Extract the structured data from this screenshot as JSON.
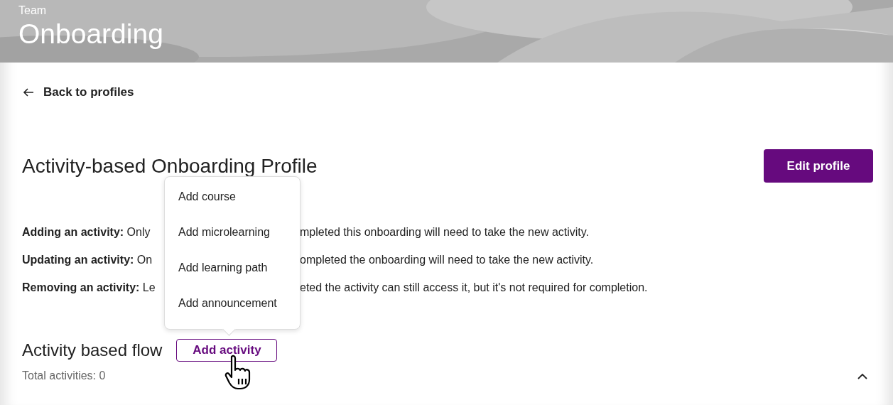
{
  "header": {
    "eyebrow": "Team",
    "title": "Onboarding"
  },
  "back_link": {
    "label": "Back to profiles"
  },
  "profile": {
    "title": "Activity-based Onboarding Profile",
    "edit_button": "Edit profile"
  },
  "rules": [
    {
      "visible_start": "**Adding an activity:** Only",
      "visible_end": "mpleted this onboarding will need to take the new activity."
    },
    {
      "visible_start": "**Updating an activity:** On",
      "visible_end": "ompleted the onboarding will need to take the new activity."
    },
    {
      "visible_start": "**Removing an activity:** Le",
      "visible_end": "eted the activity can still access it, but it's not required for completion."
    }
  ],
  "flow": {
    "title": "Activity based flow",
    "add_button": "Add activity",
    "total": "Total activities: 0",
    "expanded": true
  },
  "menu": {
    "items": [
      {
        "label": "Add course"
      },
      {
        "label": "Add microlearning"
      },
      {
        "label": "Add learning path"
      },
      {
        "label": "Add announcement"
      }
    ]
  }
}
